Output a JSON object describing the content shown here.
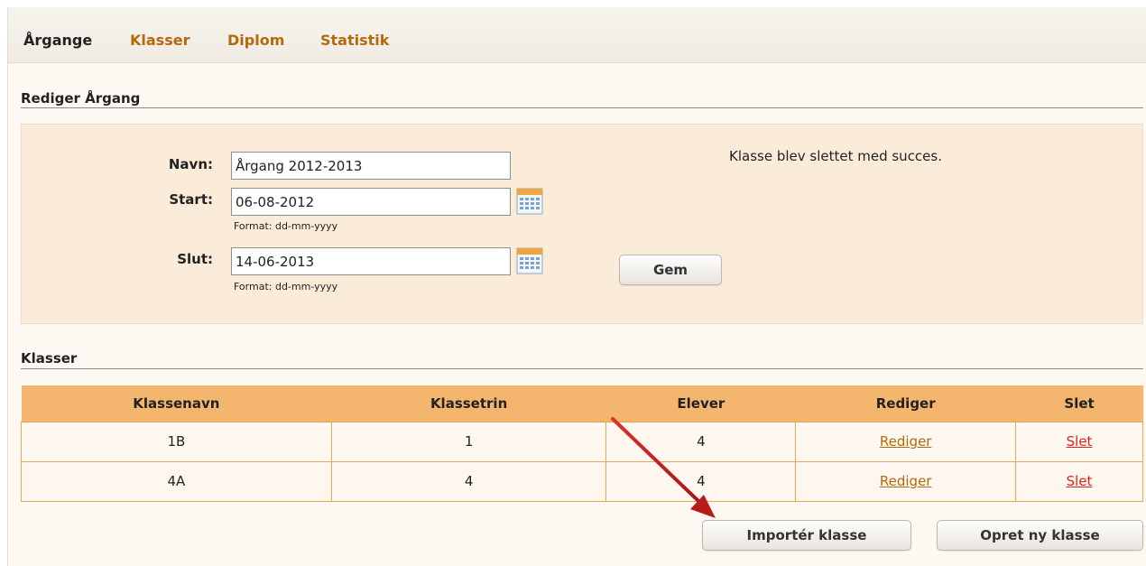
{
  "nav": {
    "active": "Årgange",
    "links": [
      "Klasser",
      "Diplom",
      "Statistik"
    ]
  },
  "edit_section": {
    "title": "Rediger Årgang",
    "name_label": "Navn:",
    "name_value": "Årgang 2012-2013",
    "start_label": "Start:",
    "start_value": "06-08-2012",
    "start_format": "Format: dd-mm-yyyy",
    "end_label": "Slut:",
    "end_value": "14-06-2013",
    "end_format": "Format: dd-mm-yyyy",
    "save_label": "Gem",
    "success_message": "Klasse blev slettet med succes."
  },
  "classes_section": {
    "title": "Klasser",
    "columns": [
      "Klassenavn",
      "Klassetrin",
      "Elever",
      "Rediger",
      "Slet"
    ],
    "rows": [
      {
        "name": "1B",
        "grade": "1",
        "students": "4",
        "edit": "Rediger",
        "delete": "Slet"
      },
      {
        "name": "4A",
        "grade": "4",
        "students": "4",
        "edit": "Rediger",
        "delete": "Slet"
      }
    ],
    "import_label": "Importér klasse",
    "create_label": "Opret ny klasse"
  },
  "colors": {
    "accent": "#b4690c",
    "table_header": "#f4b66e",
    "form_bg": "#fbecda",
    "delete_link": "#e0201e",
    "annotation_arrow": "#c0241c"
  },
  "icons": {
    "calendar": "calendar-icon",
    "annotation": "red-arrow"
  }
}
